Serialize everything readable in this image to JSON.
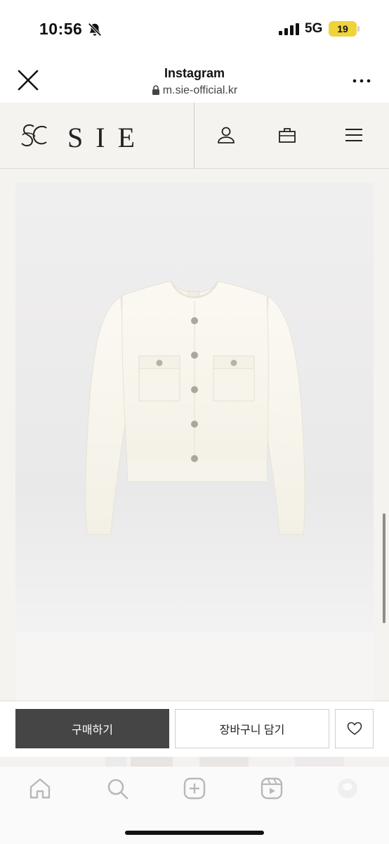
{
  "status_bar": {
    "time": "10:56",
    "network": "5G",
    "battery": "19",
    "icons": [
      "bell-slash-icon",
      "signal-icon",
      "battery-icon"
    ]
  },
  "browser": {
    "title": "Instagram",
    "url": "m.sie-official.kr",
    "icons": [
      "close-icon",
      "lock-icon",
      "more-icon"
    ]
  },
  "site_header": {
    "logo_text": "SIE",
    "icons": [
      "user-icon",
      "cart-icon",
      "menu-icon"
    ]
  },
  "product": {
    "image_alt": "ivory knit cardigan"
  },
  "purchase_bar": {
    "buy_label": "구매하기",
    "add_to_cart_label": "장바구니 담기",
    "wishlist_icon": "heart-icon"
  },
  "bottom_nav": {
    "items": [
      "home-icon",
      "search-icon",
      "create-icon",
      "reels-icon",
      "profile-icon"
    ]
  },
  "colors": {
    "site_bg": "#f5f3ef",
    "buy_button": "#454545",
    "battery": "#f0d33a"
  }
}
